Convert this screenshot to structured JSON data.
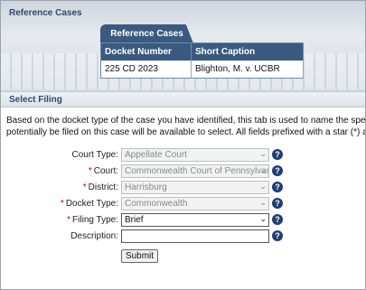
{
  "reference_cases": {
    "section_title": "Reference Cases",
    "tab_label": "Reference Cases",
    "columns": [
      "Docket Number",
      "Short Caption"
    ],
    "rows": [
      [
        "225 CD 2023",
        "Blighton, M. v. UCBR"
      ]
    ]
  },
  "select_filing": {
    "section_title": "Select Filing",
    "description_line1": "Based on the docket type of the case you have identified, this tab is used to name the specific filing",
    "description_line2": "potentially be filed on this case will be available to select. All fields prefixed with a star (*) are requir",
    "fields": [
      {
        "label": "Court Type:",
        "required": false,
        "value": "Appellate Court",
        "enabled": false
      },
      {
        "label": "Court:",
        "required": true,
        "value": "Commonwealth Court of Pennsylvan",
        "enabled": false
      },
      {
        "label": "District:",
        "required": true,
        "value": "Harrisburg",
        "enabled": false
      },
      {
        "label": "Docket Type:",
        "required": true,
        "value": "Commonwealth",
        "enabled": false
      },
      {
        "label": "Filing Type:",
        "required": true,
        "value": "Brief",
        "enabled": true
      },
      {
        "label": "Description:",
        "required": false,
        "value": "",
        "enabled": true
      }
    ],
    "star": "*",
    "help_glyph": "?",
    "chevron_glyph": "⌄",
    "submit_label": "Submit"
  },
  "colors": {
    "header_blue": "#3b5a80",
    "title_blue": "#2f4a6d",
    "required_red": "#cc0000",
    "help_blue": "#1f3f74"
  }
}
